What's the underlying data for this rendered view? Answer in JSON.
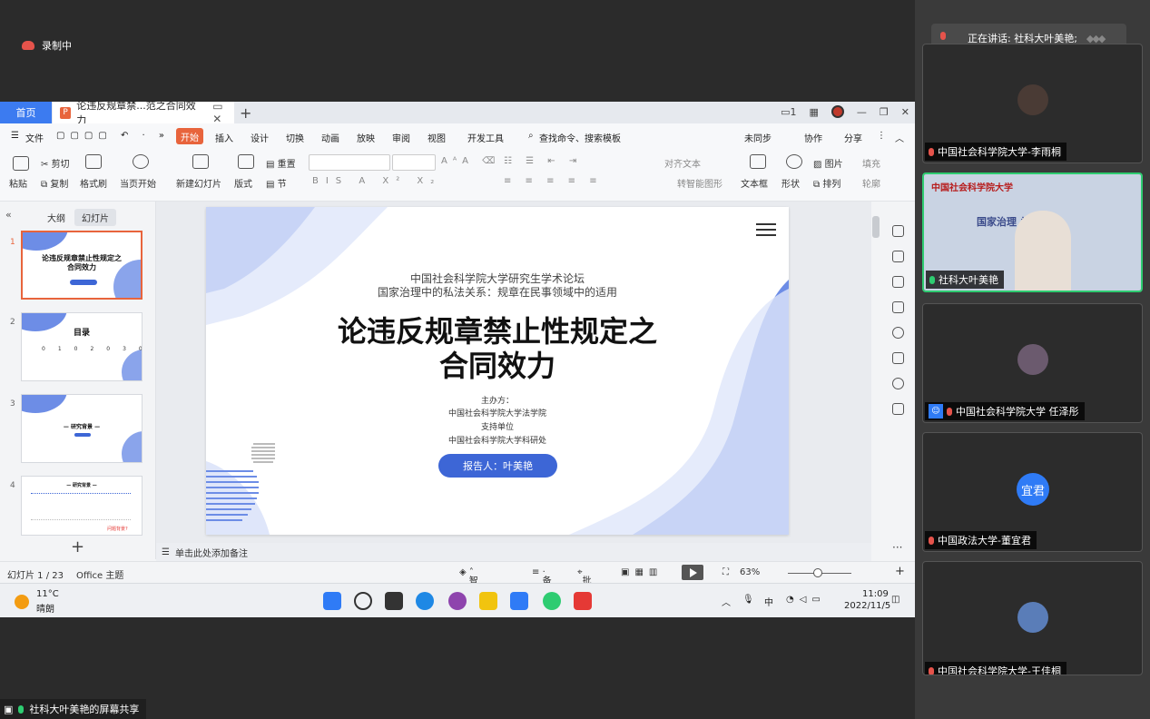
{
  "recording": {
    "label": "录制中"
  },
  "window": {
    "home_tab": "首页",
    "doc_tab": "论违反规章禁...范之合同效力",
    "menu": [
      "文件",
      "开始",
      "插入",
      "设计",
      "切换",
      "动画",
      "放映",
      "审阅",
      "视图",
      "开发工具"
    ],
    "search_placeholder": "查找命令、搜索模板",
    "right_actions": [
      "未同步",
      "协作",
      "分享"
    ],
    "ribbon": {
      "paste": "粘贴",
      "cut": "剪切",
      "copy": "复制",
      "format_painter": "格式刷",
      "from_current": "当页开始",
      "new_slide": "新建幻灯片",
      "layout": "版式",
      "section": "节",
      "reset": "重置",
      "align_text": "对齐文本",
      "smart_graphic": "转智能图形",
      "textbox": "文本框",
      "shape": "形状",
      "picture": "图片",
      "arrange": "排列",
      "fill": "填充",
      "outline": "轮廓"
    }
  },
  "left_panel": {
    "tabs": [
      "大纲",
      "幻灯片"
    ],
    "thumbs": [
      {
        "num": "1",
        "title": "论违反规章禁止性规定之\n合同效力"
      },
      {
        "num": "2",
        "title": "目录"
      },
      {
        "num": "3",
        "title": "— 研究背景 —"
      },
      {
        "num": "4",
        "title": "— 研究背景 —",
        "note": "问题背景?"
      }
    ]
  },
  "slide": {
    "forum": "中国社会科学院大学研究生学术论坛",
    "topic": "国家治理中的私法关系：规章在民事领域中的适用",
    "title_line1": "论违反规章禁止性规定之",
    "title_line2": "合同效力",
    "organizer_label": "主办方：",
    "organizer": "中国社会科学院大学法学院",
    "support_label": "支持单位",
    "supporter": "中国社会科学院大学科研处",
    "reporter": "报告人：叶美艳"
  },
  "notes": {
    "placeholder": "单击此处添加备注"
  },
  "status": {
    "slide_count": "幻灯片 1 / 23",
    "theme": "Office 主题",
    "beautify": "智能美化",
    "notes": "备注",
    "comment": "批注",
    "zoom": "63%"
  },
  "taskbar": {
    "temp": "11°C",
    "weather": "晴朗",
    "ime": "中",
    "time": "11:09",
    "date": "2022/11/5"
  },
  "participants": {
    "speaking": "正在讲话: 社科大叶美艳;",
    "tiles": [
      {
        "name": "中国社会科学院大学-李雨桐"
      },
      {
        "name": "社科大叶美艳"
      },
      {
        "name": "中国社会科学院大学 任泽彤"
      },
      {
        "name": "中国政法大学-董宜君",
        "avatar_text": "宜君"
      },
      {
        "name": "中国社会科学院大学-王佳桐"
      }
    ]
  },
  "screen_share": {
    "label": "社科大叶美艳的屏幕共享"
  },
  "colors": {
    "accent": "#e8643c",
    "blue": "#3d66d6",
    "active_border": "#2ecc71"
  }
}
